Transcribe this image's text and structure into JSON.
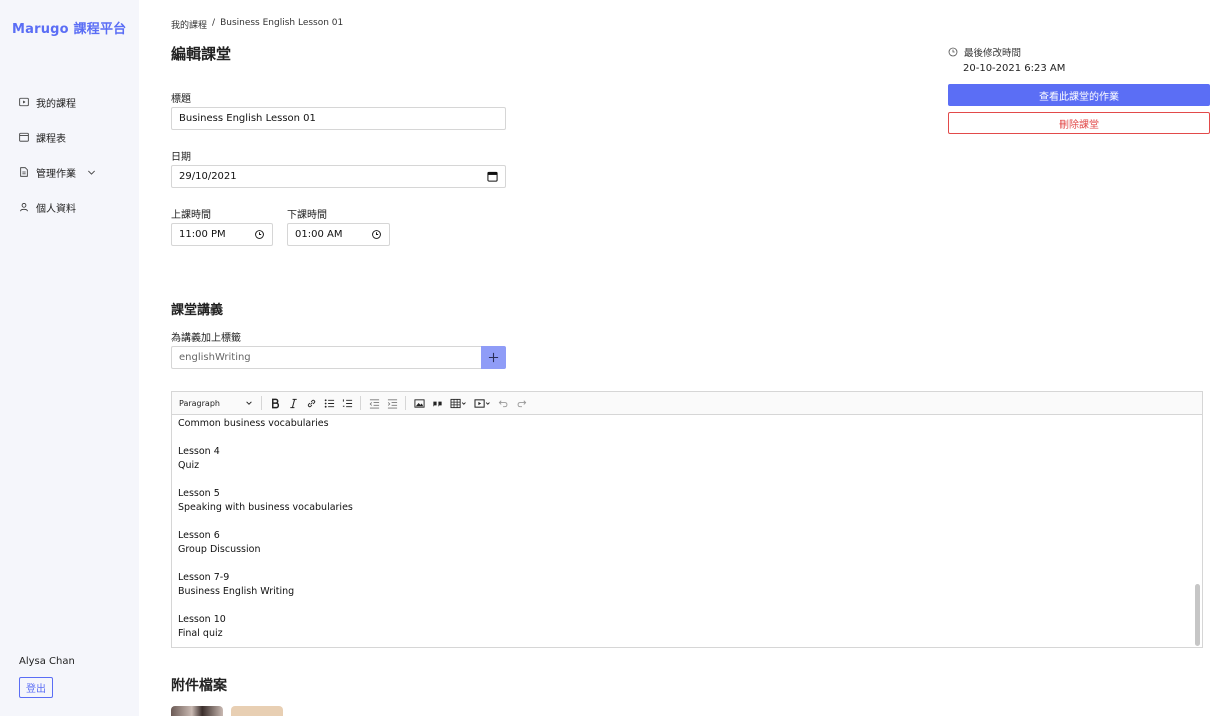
{
  "brand": "Marugo 課程平台",
  "nav": {
    "items": [
      {
        "label": "我的課程",
        "icon": "play-square-icon"
      },
      {
        "label": "課程表",
        "icon": "calendar-icon"
      },
      {
        "label": "管理作業",
        "icon": "document-icon"
      },
      {
        "label": "個人資料",
        "icon": "user-icon"
      }
    ]
  },
  "user": {
    "name": "Alysa Chan",
    "logout_label": "登出"
  },
  "breadcrumb": {
    "parent": "我的課程",
    "separator": "/",
    "current": "Business English Lesson 01"
  },
  "page": {
    "title": "編輯課堂"
  },
  "form": {
    "title_label": "標題",
    "title_value": "Business English Lesson 01",
    "date_label": "日期",
    "date_value": "29/10/2021",
    "start_label": "上課時間",
    "start_value": "11:00 PM",
    "end_label": "下課時間",
    "end_value": "01:00 AM"
  },
  "notes": {
    "section_title": "課堂講義",
    "tag_label": "為講義加上標籤",
    "tag_value": "englishWriting"
  },
  "editor": {
    "paragraph_select": "Paragraph",
    "lines": [
      "Common business vocabularies",
      "",
      "Lesson 4",
      "Quiz",
      "",
      "Lesson 5",
      "Speaking with business vocabularies",
      "",
      "Lesson 6",
      "Group Discussion",
      "",
      "Lesson 7-9",
      "Business English Writing",
      "",
      "Lesson 10",
      "Final quiz"
    ]
  },
  "attachments": {
    "title": "附件檔案"
  },
  "meta": {
    "modified_label": "最後修改時間",
    "modified_value": "20-10-2021 6:23 AM"
  },
  "actions": {
    "view_homework": "查看此課堂的作業",
    "delete_lesson": "刪除課堂"
  },
  "colors": {
    "accent": "#5b6ef5",
    "danger": "#e24a4a",
    "sidebar_bg": "#f5f6fb"
  }
}
